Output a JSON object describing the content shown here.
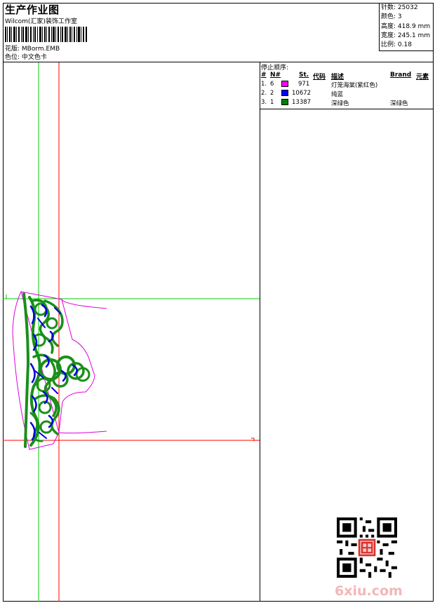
{
  "header": {
    "title": "生产作业图",
    "studio": "Wilcom(汇家)装饰工作室",
    "design_label": "花版:",
    "design_value": "MBorm.EMB",
    "color_label": "色位:",
    "color_value": "中文色卡"
  },
  "stats": {
    "stitches_label": "针数:",
    "stitches": "25032",
    "colors_label": "颜色:",
    "colors": "3",
    "height_label": "高度:",
    "height": "418.9 mm",
    "width_label": "宽度:",
    "width": "245.1 mm",
    "scale_label": "比例:",
    "scale": "0.18"
  },
  "stop_sequence": {
    "title": "停止顺序:",
    "headers": {
      "num": "#",
      "n": "N#",
      "st": "St.",
      "code": "代码",
      "desc": "描述",
      "brand": "Brand",
      "element": "元素"
    },
    "rows": [
      {
        "num": "1.",
        "n": "6",
        "color": "#ff00ff",
        "st": "971",
        "desc": "灯笼海棠(紫红色)",
        "brand": ""
      },
      {
        "num": "2.",
        "n": "2",
        "color": "#0000ff",
        "st": "10672",
        "desc": "纯蓝",
        "brand": ""
      },
      {
        "num": "3.",
        "n": "1",
        "color": "#008000",
        "st": "13387",
        "desc": "深绿色",
        "brand": "深绿色"
      }
    ]
  },
  "watermark": "6xiu.com",
  "colors": {
    "green_guide": "#00cc00",
    "red_guide": "#ff0000",
    "outline": "#ff00ff",
    "fill_green": "#1a8f1a",
    "fill_blue": "#0000dd"
  }
}
